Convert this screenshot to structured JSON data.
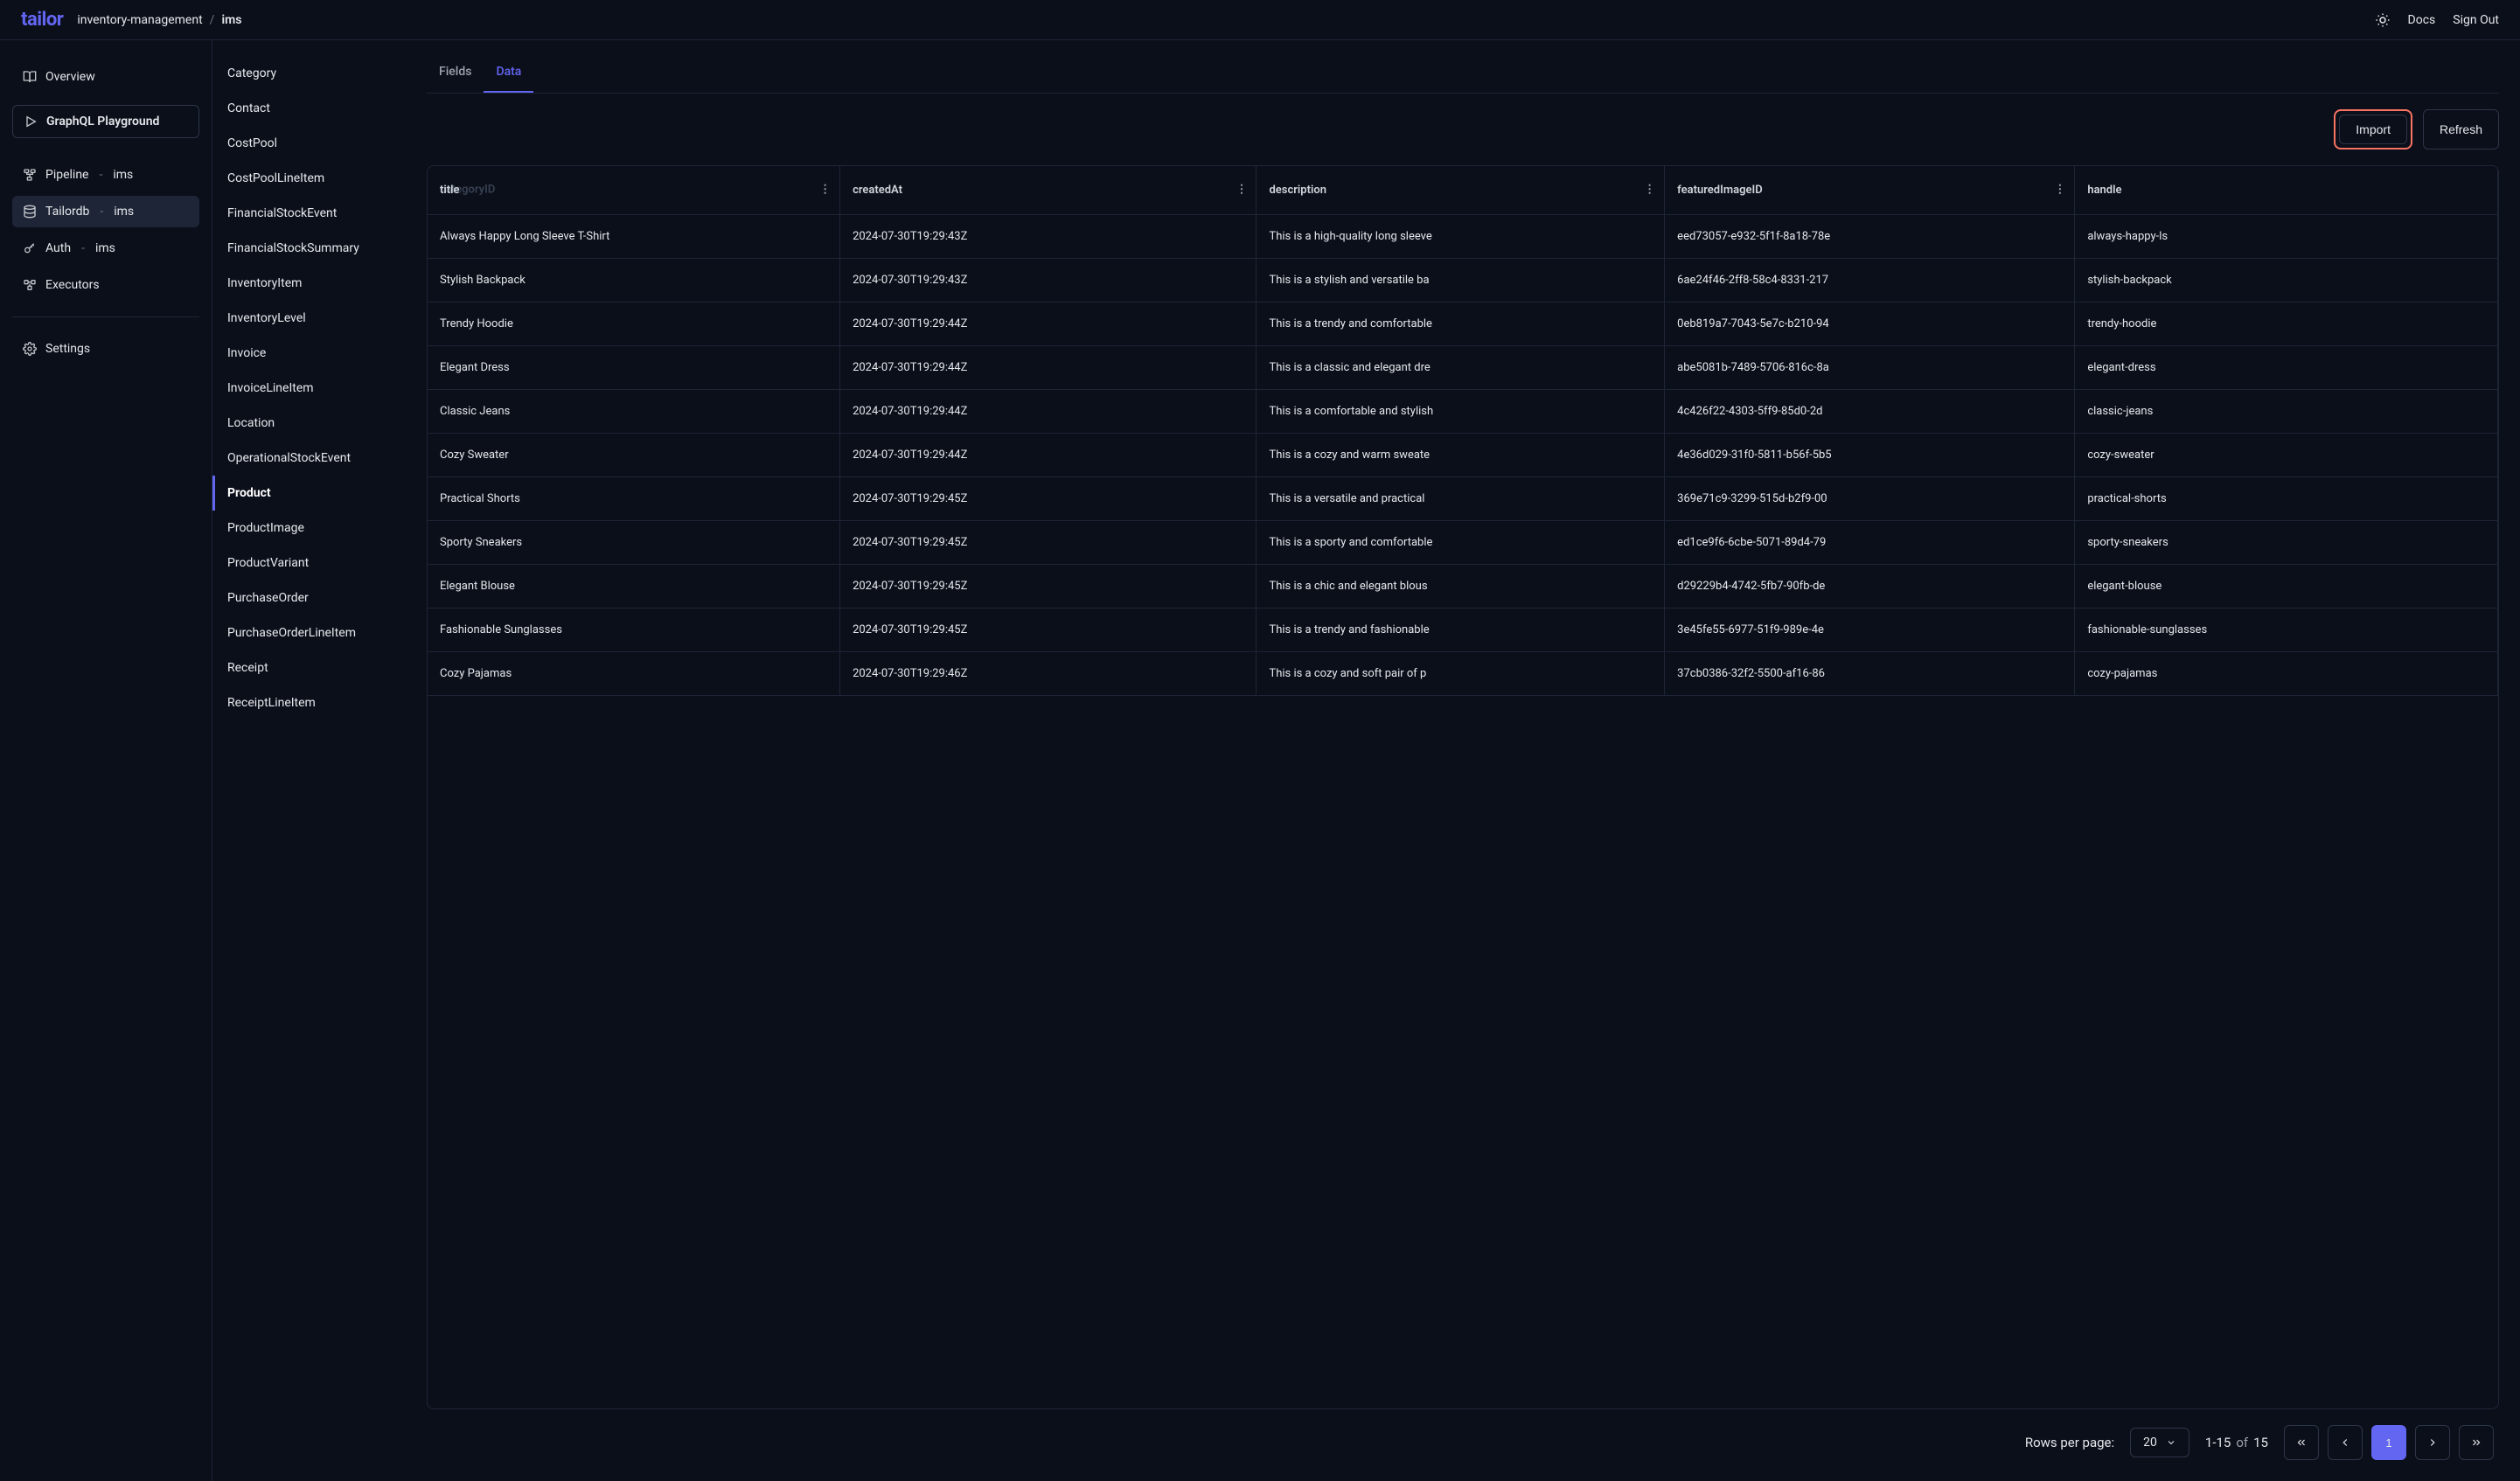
{
  "header": {
    "logo": "tailor",
    "breadcrumb_org": "inventory-management",
    "breadcrumb_sep": "/",
    "breadcrumb_app": "ims",
    "docs": "Docs",
    "signout": "Sign Out"
  },
  "sidebar": {
    "overview": "Overview",
    "playground": "GraphQL Playground",
    "pipeline_label": "Pipeline",
    "pipeline_svc": "ims",
    "tailordb_label": "Tailordb",
    "tailordb_svc": "ims",
    "auth_label": "Auth",
    "auth_svc": "ims",
    "executors": "Executors",
    "settings": "Settings",
    "sep": "-"
  },
  "entities": [
    "Category",
    "Contact",
    "CostPool",
    "CostPoolLineItem",
    "FinancialStockEvent",
    "FinancialStockSummary",
    "InventoryItem",
    "InventoryLevel",
    "Invoice",
    "InvoiceLineItem",
    "Location",
    "OperationalStockEvent",
    "Product",
    "ProductImage",
    "ProductVariant",
    "PurchaseOrder",
    "PurchaseOrderLineItem",
    "Receipt",
    "ReceiptLineItem"
  ],
  "entities_active": "Product",
  "tabs": {
    "fields": "Fields",
    "data": "Data"
  },
  "toolbar": {
    "import": "Import",
    "refresh": "Refresh"
  },
  "columns": {
    "title": "title",
    "title_ghost": "categoryID",
    "createdAt": "createdAt",
    "description": "description",
    "featuredImageID": "featuredImageID",
    "handle": "handle"
  },
  "rows": [
    {
      "title": "Always Happy Long Sleeve T-Shirt",
      "createdAt": "2024-07-30T19:29:43Z",
      "description": "This is a high-quality long sleeve",
      "featuredImageID": "eed73057-e932-5f1f-8a18-78e",
      "handle": "always-happy-ls"
    },
    {
      "title": "Stylish Backpack",
      "createdAt": "2024-07-30T19:29:43Z",
      "description": "This is a stylish and versatile ba",
      "featuredImageID": "6ae24f46-2ff8-58c4-8331-217",
      "handle": "stylish-backpack"
    },
    {
      "title": "Trendy Hoodie",
      "createdAt": "2024-07-30T19:29:44Z",
      "description": "This is a trendy and comfortable",
      "featuredImageID": "0eb819a7-7043-5e7c-b210-94",
      "handle": "trendy-hoodie"
    },
    {
      "title": "Elegant Dress",
      "createdAt": "2024-07-30T19:29:44Z",
      "description": "This is a classic and elegant dre",
      "featuredImageID": "abe5081b-7489-5706-816c-8a",
      "handle": "elegant-dress"
    },
    {
      "title": "Classic Jeans",
      "createdAt": "2024-07-30T19:29:44Z",
      "description": "This is a comfortable and stylish",
      "featuredImageID": "4c426f22-4303-5ff9-85d0-2d",
      "handle": "classic-jeans"
    },
    {
      "title": "Cozy Sweater",
      "createdAt": "2024-07-30T19:29:44Z",
      "description": "This is a cozy and warm sweate",
      "featuredImageID": "4e36d029-31f0-5811-b56f-5b5",
      "handle": "cozy-sweater"
    },
    {
      "title": "Practical Shorts",
      "createdAt": "2024-07-30T19:29:45Z",
      "description": "This is a versatile and practical",
      "featuredImageID": "369e71c9-3299-515d-b2f9-00",
      "handle": "practical-shorts"
    },
    {
      "title": "Sporty Sneakers",
      "createdAt": "2024-07-30T19:29:45Z",
      "description": "This is a sporty and comfortable",
      "featuredImageID": "ed1ce9f6-6cbe-5071-89d4-79",
      "handle": "sporty-sneakers"
    },
    {
      "title": "Elegant Blouse",
      "createdAt": "2024-07-30T19:29:45Z",
      "description": "This is a chic and elegant blous",
      "featuredImageID": "d29229b4-4742-5fb7-90fb-de",
      "handle": "elegant-blouse"
    },
    {
      "title": "Fashionable Sunglasses",
      "createdAt": "2024-07-30T19:29:45Z",
      "description": "This is a trendy and fashionable",
      "featuredImageID": "3e45fe55-6977-51f9-989e-4e",
      "handle": "fashionable-sunglasses"
    },
    {
      "title": "Cozy Pajamas",
      "createdAt": "2024-07-30T19:29:46Z",
      "description": "This is a cozy and soft pair of p",
      "featuredImageID": "37cb0386-32f2-5500-af16-86",
      "handle": "cozy-pajamas"
    }
  ],
  "pager": {
    "rows_label": "Rows per page:",
    "page_size": "20",
    "range": "1-15",
    "of": "of",
    "total": "15",
    "current": "1"
  }
}
